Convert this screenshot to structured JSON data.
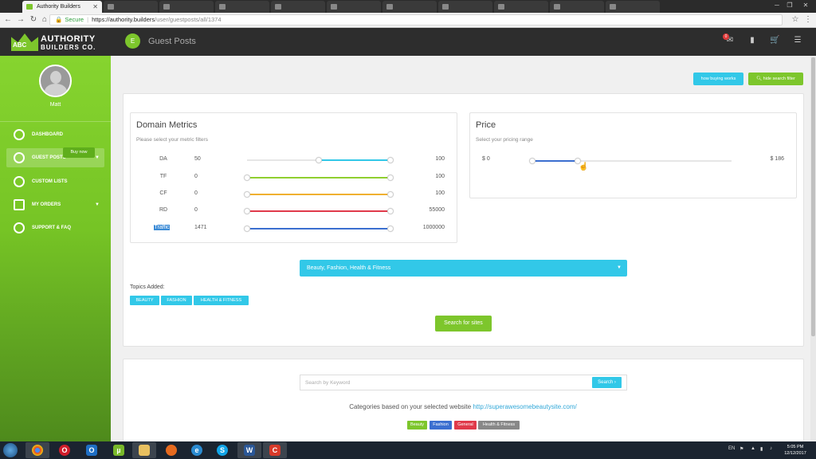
{
  "browser": {
    "tabs": [
      {
        "label": "Authority Builders",
        "active": true
      },
      {
        "label": "",
        "active": false
      },
      {
        "label": "",
        "active": false
      },
      {
        "label": "",
        "active": false
      },
      {
        "label": "",
        "active": false
      },
      {
        "label": "",
        "active": false
      },
      {
        "label": "",
        "active": false
      },
      {
        "label": "",
        "active": false
      },
      {
        "label": "",
        "active": false
      },
      {
        "label": "",
        "active": false
      },
      {
        "label": "",
        "active": false
      }
    ],
    "secure_label": "Secure",
    "url_host": "https://authority.builders",
    "url_path": "/user/guestposts/all/1374"
  },
  "header": {
    "logo_abc": "ABC",
    "logo_line1": "AUTHORITY",
    "logo_line2": "BUILDERS CO.",
    "page_badge": "E",
    "page_title": "Guest Posts",
    "notification_count": "0"
  },
  "sidebar": {
    "username": "Matt",
    "buy_now": "Buy now",
    "items": [
      {
        "label": "DASHBOARD",
        "active": false
      },
      {
        "label": "GUEST POSTS",
        "active": true
      },
      {
        "label": "CUSTOM LISTS",
        "active": false
      },
      {
        "label": "MY ORDERS",
        "active": false
      },
      {
        "label": "SUPPORT & FAQ",
        "active": false
      }
    ]
  },
  "top_buttons": {
    "how_buying_works": "how buying works",
    "hide_search_filter": "hide search filter"
  },
  "domain_metrics": {
    "title": "Domain Metrics",
    "subtitle": "Please select your metric filters",
    "rows": [
      {
        "label": "DA",
        "min": "50",
        "max": "100",
        "color": "#32c8e8"
      },
      {
        "label": "TF",
        "min": "0",
        "max": "100",
        "color": "#8fcf2f"
      },
      {
        "label": "CF",
        "min": "0",
        "max": "100",
        "color": "#f0b030"
      },
      {
        "label": "RD",
        "min": "0",
        "max": "55000",
        "color": "#e03a4a"
      },
      {
        "label": "Traffic",
        "min": "1471",
        "max": "1000000",
        "color": "#3b6fd0"
      }
    ]
  },
  "price": {
    "title": "Price",
    "subtitle": "Select your pricing range",
    "min": "$ 0",
    "max": "$ 186",
    "color": "#3b6fd0"
  },
  "topics": {
    "dropdown": "Beauty, Fashion, Health & Fitness",
    "label": "Topics Added:",
    "tags": [
      "BEAUTY",
      "FASHION",
      "HEALTH & FITNESS"
    ],
    "search_button": "Search for sites"
  },
  "keyword": {
    "placeholder": "Search by Keyword",
    "button": "Search ›",
    "categories_text": "Categories based on your selected website",
    "categories_link": "http://superawesomebeautysite.com/",
    "categories": [
      {
        "label": "Beauty",
        "color": "#7dc62c"
      },
      {
        "label": "Fashion",
        "color": "#3b6fd0"
      },
      {
        "label": "General",
        "color": "#e03a4a"
      },
      {
        "label": "Health & Fitness",
        "color": "#888888"
      }
    ]
  },
  "taskbar": {
    "lang": "EN",
    "time": "5:05 PM",
    "date": "12/12/2017"
  }
}
